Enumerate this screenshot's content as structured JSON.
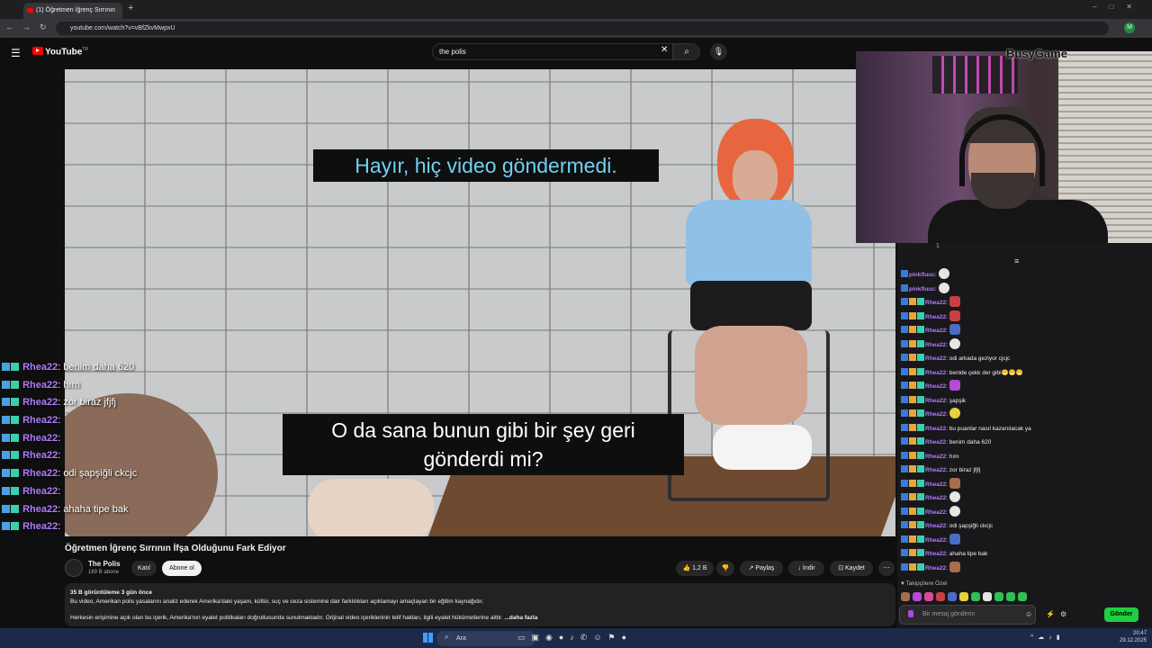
{
  "browser": {
    "tab_title": "(1) Öğretmen İğrenç Sırrının",
    "url": "youtube.com/watch?v=vBfZkvMwpxU",
    "nav_glyphs": "←→↻",
    "window_controls": "–□✕",
    "profile_initial": "M"
  },
  "youtube": {
    "logo": "YouTube",
    "logo_superscript": "TR",
    "search_value": "the polis",
    "video": {
      "subtitle_top": "Hayır, hiç video göndermedi.",
      "subtitle_bottom_1": "O da sana bunun gibi bir şey geri",
      "subtitle_bottom_2": "gönderdi mi?"
    },
    "title": "Öğretmen İğrenç Sırrının İfşa Olduğunu Fark Ediyor",
    "channel": {
      "name": "The Polis",
      "subscribers": "169 B abone",
      "join_label": "Katıl",
      "subscribe_label": "Abone ol"
    },
    "actions": {
      "likes": "1,2 B",
      "share": "Paylaş",
      "download": "İndir",
      "save": "Kaydet"
    },
    "description": {
      "meta": "35 B görüntüleme  3 gün önce",
      "line1": "Bu video, Amerikan polis yasalarını analiz ederek Amerika'daki yaşam, kültür, suç ve ceza sistemine dair farklılıkları açıklamayı amaçlayan bir eğitim kaynağıdır.",
      "line2": "Herkesin erişimine açık olan bu içerik, Amerika'nın eyalet politikaları doğrultusunda sunulmaktadır. Orijinal video içeriklerinin telif hakları, ilgili eyalet hükümetlerine aittir.",
      "more": " ...daha fazla"
    }
  },
  "overlay_chat": [
    {
      "user": "Rhea22",
      "msg": ": benim daha 620"
    },
    {
      "user": "Rhea22",
      "msg": ": hım"
    },
    {
      "user": "Rhea22",
      "msg": ": zor biraz jfjfj"
    },
    {
      "user": "Rhea22",
      "msg": ": "
    },
    {
      "user": "Rhea22",
      "msg": ": "
    },
    {
      "user": "Rhea22",
      "msg": ": "
    },
    {
      "user": "Rhea22",
      "msg": ": odi şapşiğli ckcjc"
    },
    {
      "user": "Rhea22",
      "msg": ": "
    },
    {
      "user": "Rhea22",
      "msg": ": ahaha tipe bak"
    },
    {
      "user": "Rhea22",
      "msg": ": "
    }
  ],
  "webcam_brand": "BusyGame",
  "right_chat": {
    "top_count": "1",
    "messages": [
      {
        "user": "pinkfluuc",
        "msg": ":",
        "emo": "w"
      },
      {
        "user": "pinkfluuc",
        "msg": ":",
        "emo": "w"
      },
      {
        "user": "Rhea22",
        "msg": ":",
        "emo": "r"
      },
      {
        "user": "Rhea22",
        "msg": ":",
        "emo": "r"
      },
      {
        "user": "Rhea22",
        "msg": ":",
        "emo": "bl"
      },
      {
        "user": "Rhea22",
        "msg": ":",
        "emo": "w"
      },
      {
        "user": "Rhea22",
        "msg": ": odi arkada geziyor cjcjc",
        "emo": ""
      },
      {
        "user": "Rhea22",
        "msg": ": benide çekk der gibi😁😁😁",
        "emo": ""
      },
      {
        "user": "Rhea22",
        "msg": ":",
        "emo": "p"
      },
      {
        "user": "Rhea22",
        "msg": ": şapşik",
        "emo": ""
      },
      {
        "user": "Rhea22",
        "msg": ":",
        "emo": "yl"
      },
      {
        "user": "Rhea22",
        "msg": ": bu puanlar nasıl kazanılacak ya",
        "emo": ""
      },
      {
        "user": "Rhea22",
        "msg": ": benim daha 620",
        "emo": ""
      },
      {
        "user": "Rhea22",
        "msg": ": hım",
        "emo": ""
      },
      {
        "user": "Rhea22",
        "msg": ": zor biraz jfjfj",
        "emo": ""
      },
      {
        "user": "Rhea22",
        "msg": ":",
        "emo": "br"
      },
      {
        "user": "Rhea22",
        "msg": ":",
        "emo": "w"
      },
      {
        "user": "Rhea22",
        "msg": ":",
        "emo": "w"
      },
      {
        "user": "Rhea22",
        "msg": ": odi şapşiğli ckcjc",
        "emo": ""
      },
      {
        "user": "Rhea22",
        "msg": ":",
        "emo": "bl"
      },
      {
        "user": "Rhea22",
        "msg": ": ahaha tipe bak",
        "emo": ""
      },
      {
        "user": "Rhea22",
        "msg": ":",
        "emo": "br"
      }
    ],
    "followers_label": "♥ Takipçilere Özel",
    "input_placeholder": "Bir mesaj gönderin",
    "send_label": "Gönder"
  },
  "taskbar": {
    "search_label": "Ara",
    "clock_time": "20:47",
    "clock_date": "29.12.2025"
  },
  "colors": {
    "username": "#b07cff",
    "subtitle_cyan": "#6fd1f2",
    "send_green": "#1fcf40",
    "yt_red": "#ff0000"
  }
}
